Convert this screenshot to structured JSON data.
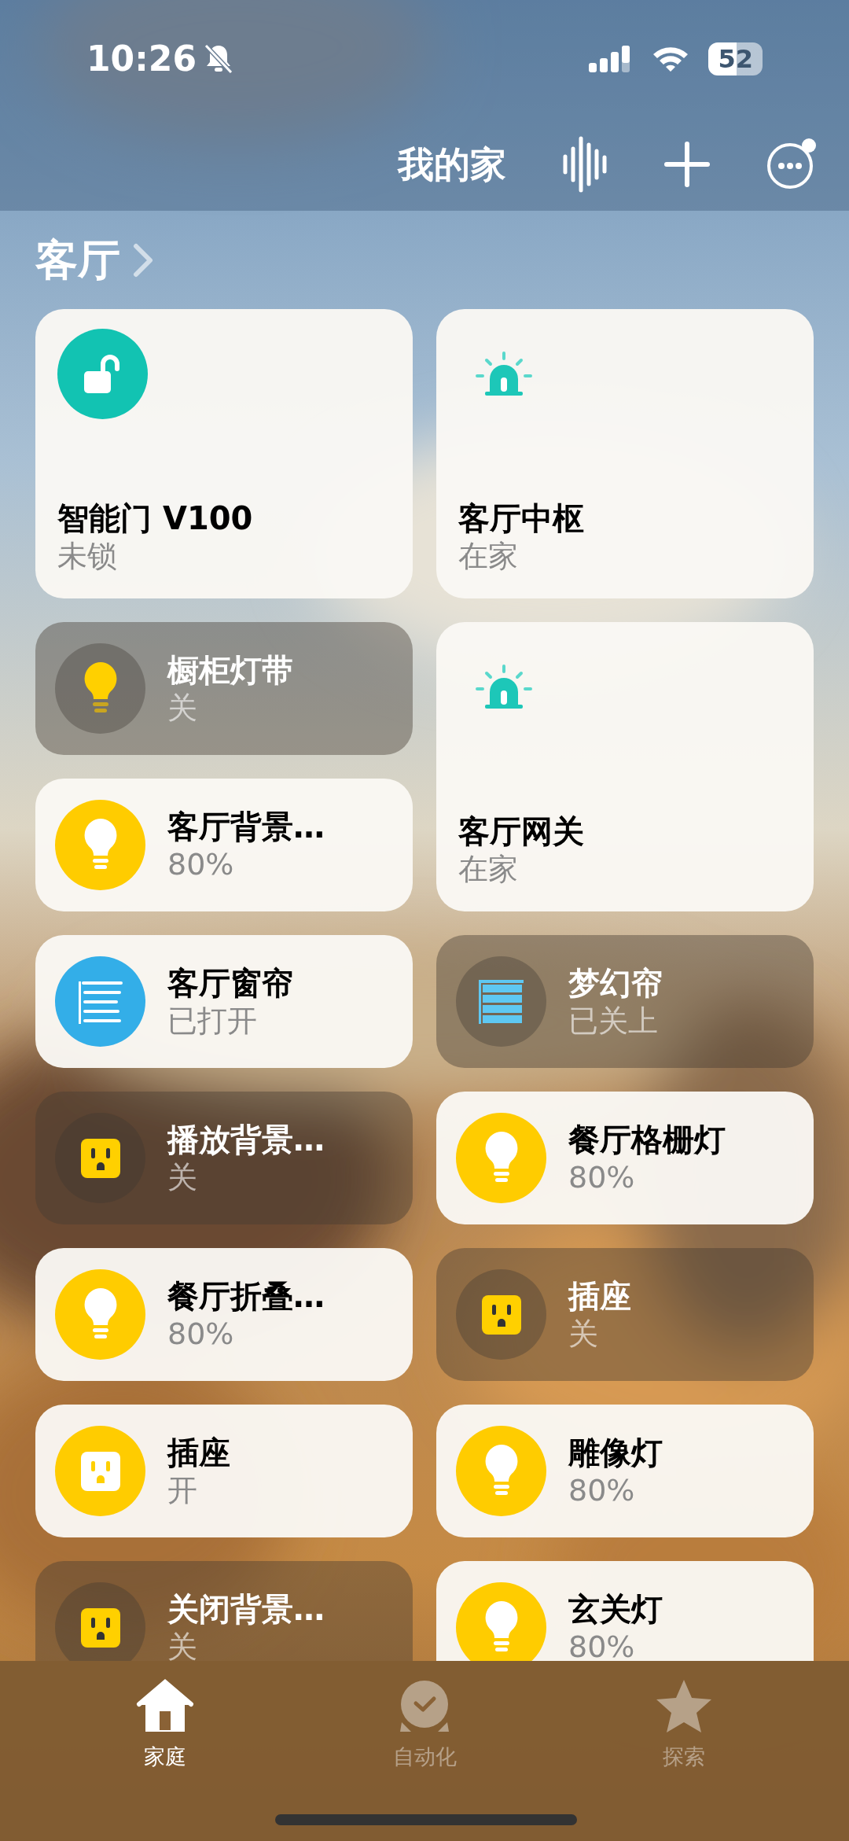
{
  "status_bar": {
    "time": "10:26",
    "battery": "52"
  },
  "header": {
    "title": "我的家"
  },
  "section": {
    "title": "客厅"
  },
  "tiles": [
    {
      "kind": "lock",
      "name": "智能门 V100",
      "status": "未锁",
      "on": true
    },
    {
      "kind": "hub",
      "name": "客厅中枢",
      "status": "在家",
      "on": true
    },
    {
      "kind": "bulb",
      "name": "橱柜灯带",
      "status": "关",
      "on": false
    },
    {
      "kind": "bulb",
      "name": "客厅背景…",
      "status": "80%",
      "on": true
    },
    {
      "kind": "hub",
      "name": "客厅网关",
      "status": "在家",
      "on": true
    },
    {
      "kind": "blinds",
      "name": "客厅窗帘",
      "status": "已打开",
      "on": true
    },
    {
      "kind": "blinds",
      "name": "梦幻帘",
      "status": "已关上",
      "on": false
    },
    {
      "kind": "outlet",
      "name": "播放背景…",
      "status": "关",
      "on": false
    },
    {
      "kind": "bulb",
      "name": "餐厅格栅灯",
      "status": "80%",
      "on": true
    },
    {
      "kind": "bulb",
      "name": "餐厅折叠…",
      "status": "80%",
      "on": true
    },
    {
      "kind": "outlet",
      "name": "插座",
      "status": "关",
      "on": false
    },
    {
      "kind": "outlet",
      "name": "插座",
      "status": "开",
      "on": true
    },
    {
      "kind": "bulb",
      "name": "雕像灯",
      "status": "80%",
      "on": true
    },
    {
      "kind": "outlet",
      "name": "关闭背景…",
      "status": "关",
      "on": false
    },
    {
      "kind": "bulb",
      "name": "玄关灯",
      "status": "80%",
      "on": true
    }
  ],
  "tab_bar": [
    {
      "label": "家庭",
      "selected": true
    },
    {
      "label": "自动化",
      "selected": false
    },
    {
      "label": "探索",
      "selected": false
    }
  ]
}
